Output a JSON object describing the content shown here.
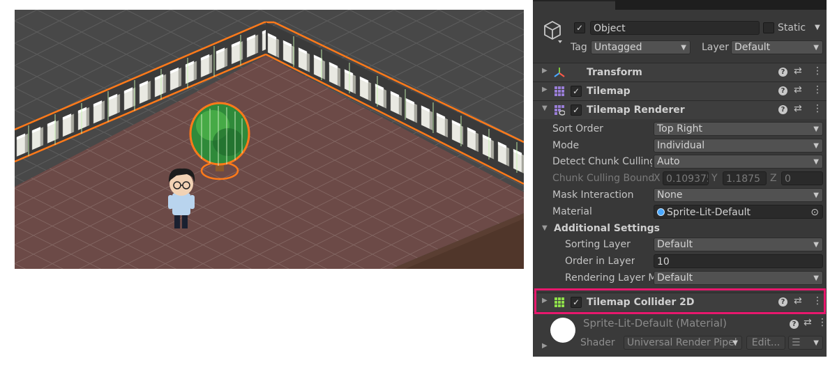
{
  "inspector": {
    "object_name": "Object",
    "static_label": "Static",
    "tag_label": "Tag",
    "tag_value": "Untagged",
    "layer_label": "Layer",
    "layer_value": "Default",
    "components": [
      {
        "title": "Transform",
        "icon": "transform-axes-icon",
        "has_checkbox": false
      },
      {
        "title": "Tilemap",
        "icon": "tilemap-grid-icon",
        "has_checkbox": true
      },
      {
        "title": "Tilemap Renderer",
        "icon": "tilemap-renderer-icon",
        "has_checkbox": true
      },
      {
        "title": "Tilemap Collider 2D",
        "icon": "tilemap-collider-icon",
        "has_checkbox": true
      }
    ],
    "renderer": {
      "sort_order_label": "Sort Order",
      "sort_order_value": "Top Right",
      "mode_label": "Mode",
      "mode_value": "Individual",
      "detect_label": "Detect Chunk Culling",
      "detect_value": "Auto",
      "bounds_label": "Chunk Culling Bound:",
      "bounds_x_label": "X",
      "bounds_x": "0.109375",
      "bounds_y_label": "Y",
      "bounds_y": "1.1875",
      "bounds_z_label": "Z",
      "bounds_z": "0",
      "mask_label": "Mask Interaction",
      "mask_value": "None",
      "material_label": "Material",
      "material_value": "Sprite-Lit-Default",
      "additional_label": "Additional Settings",
      "sorting_layer_label": "Sorting Layer",
      "sorting_layer_value": "Default",
      "order_label": "Order in Layer",
      "order_value": "10",
      "rendering_layer_label": "Rendering Layer M",
      "rendering_layer_value": "Default"
    },
    "material_preview": {
      "title": "Sprite-Lit-Default (Material)",
      "shader_label": "Shader",
      "shader_value": "Universal Render Pipel",
      "edit_label": "Edit..."
    }
  },
  "colors": {
    "highlight": "#e8186d",
    "selection_outline": "#ff7a1a",
    "floor": "#6e4a48",
    "grid": "#5a5a5a",
    "collider_line": "#c6f5b0"
  }
}
